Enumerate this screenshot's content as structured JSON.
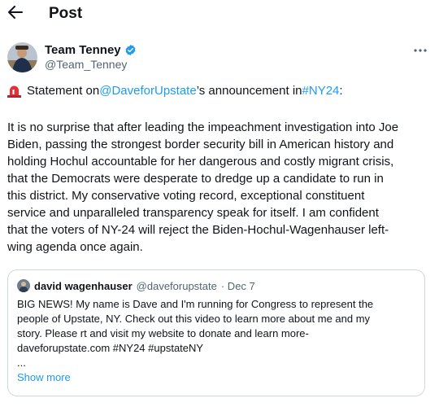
{
  "header": {
    "title": "Post",
    "back_icon": "arrow-left-icon"
  },
  "author": {
    "name": "Team Tenney",
    "handle": "@Team_Tenney",
    "verified_icon": "verified-badge-icon",
    "more_icon": "more-horizontal-icon"
  },
  "post": {
    "line1_prefix": "Statement on ",
    "line1_mention": "@DaveforUpstate",
    "line1_middle": "’s announcement in ",
    "line1_hashtag": "#NY24",
    "line1_suffix": ":",
    "body": "It is no surprise that after leading the impeachment investigation into Joe\nBiden, passing the strongest border security bill in American history and\nholding Hochul accountable for her dangerous and costly migrant crisis,\nthat the Democrats were desperate to dredge up a candidate to run in\nthis district. My conservative voting record, exceptional constituent\nservice and unparalleled transparency speak for itself. I am confident\nthat the voters of NY-24 will reject the Biden-Hochul-Wagenhauser left-\nwing agenda once again."
  },
  "quote": {
    "name": "david wagenhauser",
    "handle": "@daveforupstate",
    "date": "· Dec 7",
    "text": "BIG NEWS! My name is Dave and I'm running for Congress to represent the\npeople of Upstate, NY. Check out this video to learn more about me and my\nstory. Please rt and visit my website to donate and learn more-\ndaveforupstate.com #NY24 #upstateNY\n...",
    "show_more": "Show more"
  },
  "colors": {
    "link": "#1d9bf0",
    "secondary": "#536471",
    "border": "#cfd9de"
  }
}
